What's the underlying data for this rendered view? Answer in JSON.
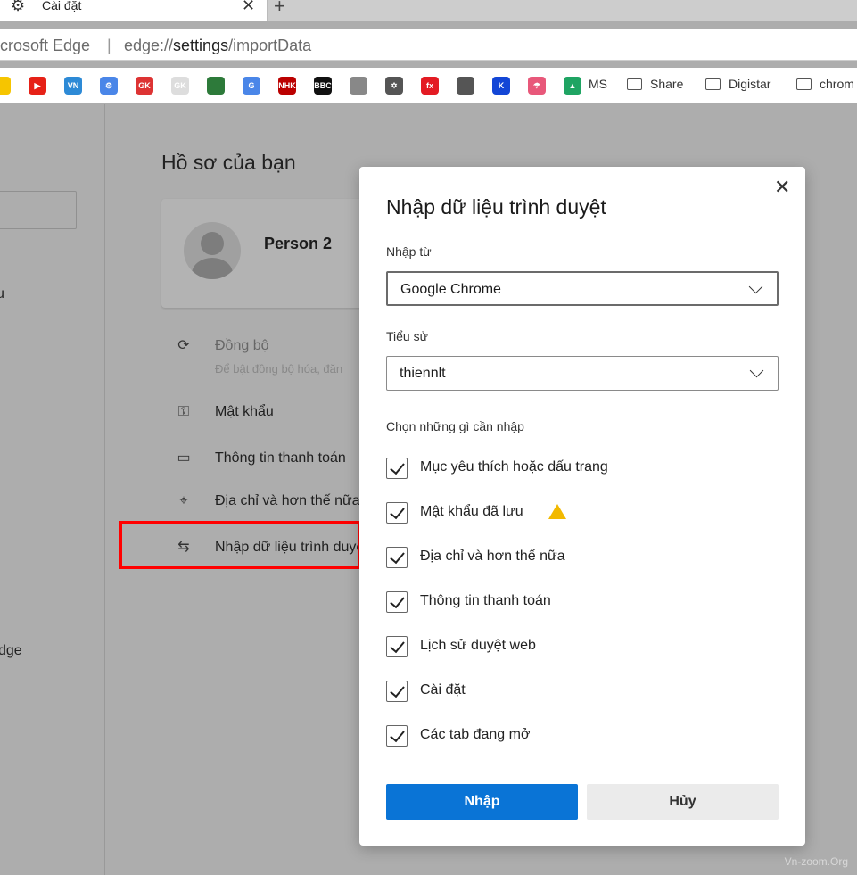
{
  "tab": {
    "title": "Cài đặt",
    "icon": "gear-icon"
  },
  "address": {
    "site": "crosoft Edge",
    "separator": "|",
    "url_prefix": "edge://",
    "url_host": "settings",
    "url_path": "/importData"
  },
  "bookmarks": {
    "icons": [
      {
        "name": "yellow-icon",
        "color": "#f6c500",
        "text": ""
      },
      {
        "name": "youtube-icon",
        "color": "#e62117",
        "text": "▶"
      },
      {
        "name": "vnzoom-icon",
        "color": "#2d8ad6",
        "text": "VN"
      },
      {
        "name": "settings-bm-icon",
        "color": "#4a86e8",
        "text": "⚙"
      },
      {
        "name": "gk-red-icon",
        "color": "#d33",
        "text": "GK"
      },
      {
        "name": "gk-icon",
        "color": "#ddd",
        "text": "GK"
      },
      {
        "name": "leaf-icon",
        "color": "#2d7a3a",
        "text": ""
      },
      {
        "name": "google-translate-icon",
        "color": "#4a86e8",
        "text": "G"
      },
      {
        "name": "nhk-icon",
        "color": "#b00",
        "text": "NHK"
      },
      {
        "name": "bbc-icon",
        "color": "#111",
        "text": "BBC"
      },
      {
        "name": "troll-icon",
        "color": "#888",
        "text": ""
      },
      {
        "name": "star-box-icon",
        "color": "#555",
        "text": "✡"
      },
      {
        "name": "fx-icon",
        "color": "#e31b23",
        "text": "fx"
      },
      {
        "name": "robot-icon",
        "color": "#555",
        "text": ""
      },
      {
        "name": "k-icon",
        "color": "#1346d6",
        "text": "K"
      },
      {
        "name": "umbrella-icon",
        "color": "#e8587a",
        "text": "☂"
      },
      {
        "name": "google-drive-icon",
        "color": "#1fa463",
        "text": "▲"
      }
    ],
    "labels": [
      "MS",
      "Share",
      "Digistar",
      "chrom"
    ]
  },
  "sidebar": {
    "partial_texts": [
      "u",
      "dge"
    ]
  },
  "profile": {
    "heading": "Hồ sơ của bạn",
    "name": "Person 2",
    "items": [
      {
        "icon": "sync-icon",
        "glyph": "⟳",
        "label": "Đồng bộ",
        "sub": "Để bật đồng bộ hóa, đăn"
      },
      {
        "icon": "key-icon",
        "glyph": "⚿",
        "label": "Mật khẩu"
      },
      {
        "icon": "card-icon",
        "glyph": "▭",
        "label": "Thông tin thanh toán"
      },
      {
        "icon": "location-icon",
        "glyph": "⌖",
        "label": "Địa chỉ và hơn thế nữa"
      },
      {
        "icon": "import-icon",
        "glyph": "⇆",
        "label": "Nhập dữ liệu trình duyệt"
      }
    ]
  },
  "dialog": {
    "title": "Nhập dữ liệu trình duyệt",
    "import_from_label": "Nhập từ",
    "import_from_value": "Google Chrome",
    "profile_label": "Tiểu sử",
    "profile_value": "thiennlt",
    "choose_label": "Chọn những gì cần nhập",
    "options": [
      {
        "label": "Mục yêu thích hoặc dấu trang",
        "checked": true
      },
      {
        "label": "Mật khẩu đã lưu",
        "checked": true,
        "warning": true
      },
      {
        "label": "Địa chỉ và hơn thế nữa",
        "checked": true
      },
      {
        "label": "Thông tin thanh toán",
        "checked": true
      },
      {
        "label": "Lịch sử duyệt web",
        "checked": true
      },
      {
        "label": "Cài đặt",
        "checked": true
      },
      {
        "label": "Các tab đang mở",
        "checked": true
      }
    ],
    "import_button": "Nhập",
    "cancel_button": "Hủy",
    "accent": "#0a74d6"
  },
  "watermark": "Vn-zoom.Org"
}
